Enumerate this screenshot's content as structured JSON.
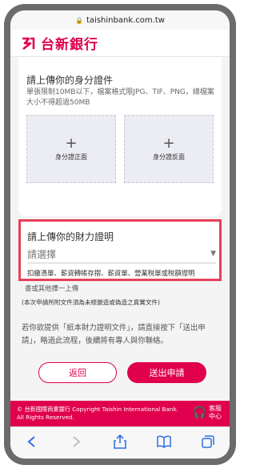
{
  "browser": {
    "url": "taishinbank.com.tw",
    "lock_icon": "lock-icon"
  },
  "header": {
    "logo_mark": "台",
    "brand_name": "台新銀行"
  },
  "id_upload": {
    "title": "請上傳你的身分證件",
    "note": "單張限制10MB以下，檔案格式限JPG、TIF、PNG，總檔案大小不得超過50MB",
    "front_label": "身分證正面",
    "back_label": "身分證反面",
    "plus": "+"
  },
  "financial": {
    "title": "請上傳你的財力證明",
    "select_placeholder": "請選擇",
    "description": "扣繳憑單、薪資轉帳存摺、薪資單、營業稅單或稅額證明",
    "description_more": "書或其他擇一上傳"
  },
  "disclaimer": "(本次申請所附文件須為未經變造或偽造之真實文件)",
  "paper_note": "若你欲提供「紙本財力證明文件」，請直接按下「送出申請」，略過此流程，後續將有專人與你聯絡。",
  "buttons": {
    "back": "返回",
    "submit": "送出申請"
  },
  "footer": {
    "copyright": "© 台新國際商業銀行 Copyright Taishin International Bank. All Rights Reserved.",
    "customer_service": "客服中心",
    "cs_icon": "headset-icon"
  },
  "toolbar": {
    "icons": [
      "back-arrow-icon",
      "forward-arrow-icon",
      "share-icon",
      "bookmarks-icon",
      "tabs-icon"
    ]
  },
  "colors": {
    "brand": "#e0004d",
    "highlight_border": "#e8405a",
    "ios_blue": "#2f6fe4"
  }
}
